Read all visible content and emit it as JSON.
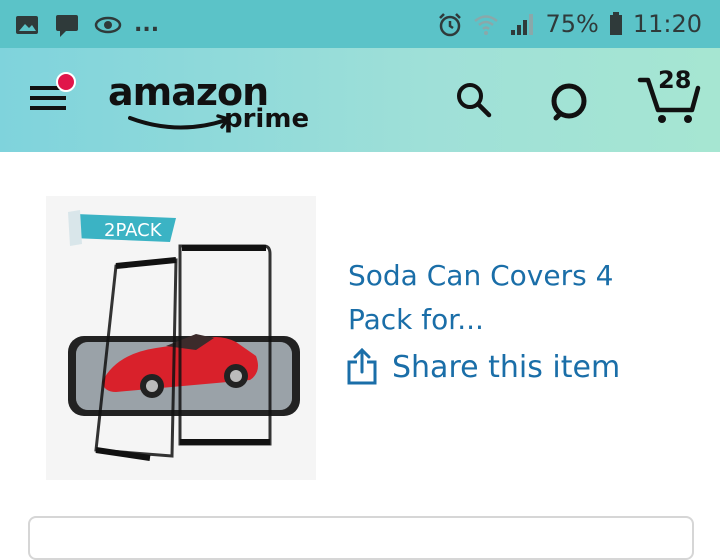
{
  "status_bar": {
    "left_icons": [
      "image-icon",
      "chat-icon",
      "eye-icon"
    ],
    "overflow": "...",
    "battery": "75%",
    "time": "11:20"
  },
  "header": {
    "logo_word": "amazon",
    "logo_sub": "prime",
    "cart_count": "28",
    "menu_notification": true
  },
  "product": {
    "image_badge": "2PACK",
    "title": "Soda Can Covers 4 Pack for...",
    "share_label": "Share this item"
  },
  "colors": {
    "status_bar": "#5bc3c8",
    "header_start": "#7fd3dc",
    "header_end": "#a6e6d2",
    "link": "#1a6ea8",
    "notification": "#e0154a",
    "car_red": "#d9212b"
  }
}
